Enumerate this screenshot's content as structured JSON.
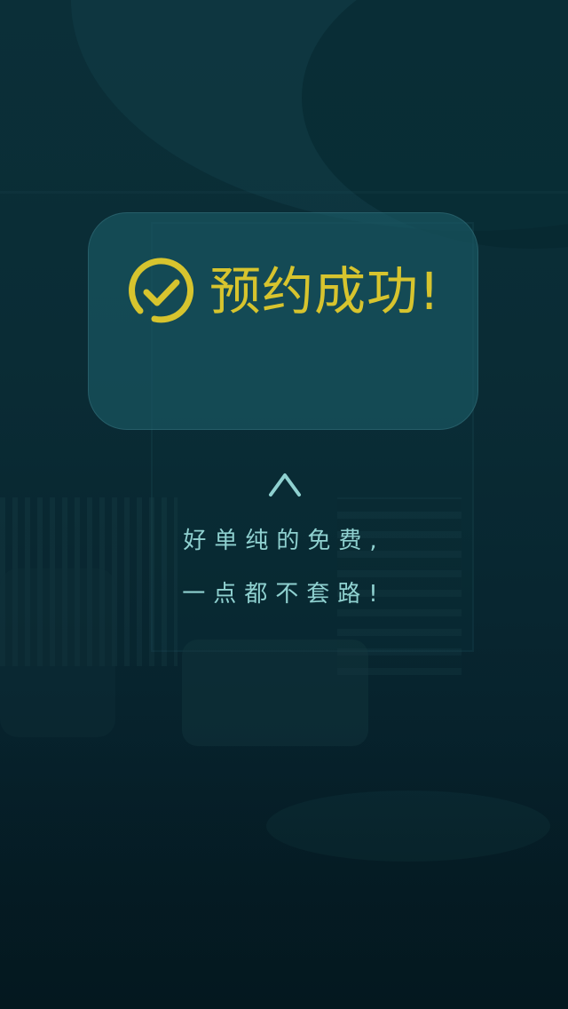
{
  "success": {
    "title": "预约成功!",
    "icon": "check-circle-icon",
    "accent_color": "#d7c42e"
  },
  "hint": {
    "icon": "chevron-up-icon",
    "line1": "好单纯的免费,",
    "line2": "一点都不套路!",
    "text_color": "#8fd1d0"
  }
}
